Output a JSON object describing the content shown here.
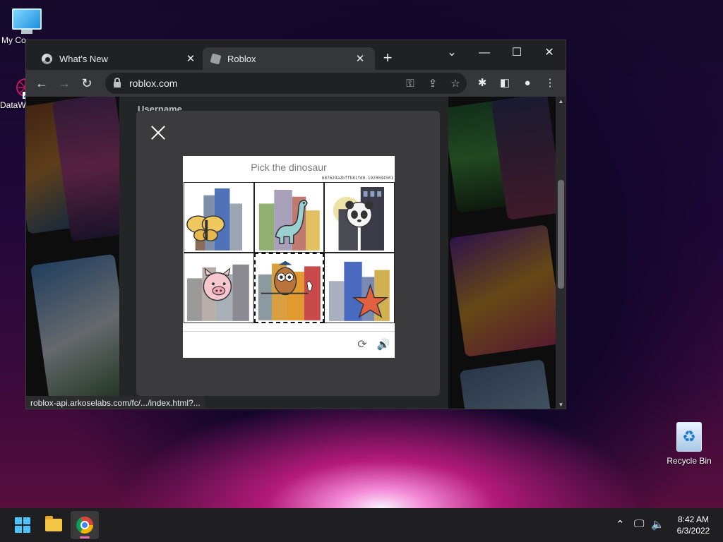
{
  "desktop": {
    "icons": [
      {
        "label": "My Co"
      },
      {
        "label": "DataW"
      },
      {
        "label": "Recycle Bin"
      }
    ]
  },
  "browser": {
    "tabs": [
      {
        "title": "What's New"
      },
      {
        "title": "Roblox"
      }
    ],
    "url": "roblox.com",
    "status_url": "roblox-api.arkoselabs.com/fc/.../index.html?..."
  },
  "page": {
    "username_label": "Username"
  },
  "captcha": {
    "prompt": "Pick the dinosaur",
    "session_id": "687629a2bffb81fd0.1920034501",
    "tiles": [
      {
        "animal": "butterfly"
      },
      {
        "animal": "dinosaur"
      },
      {
        "animal": "panda"
      },
      {
        "animal": "pig"
      },
      {
        "animal": "owl",
        "selected": true
      },
      {
        "animal": "starfish"
      }
    ]
  },
  "taskbar": {
    "time": "8:42 AM",
    "date": "6/3/2022"
  },
  "colors": {
    "browser_bg": "#202124",
    "toolbar_bg": "#35363a",
    "modal_bg": "#3b3b3d",
    "windows_accent": "#4cc2ff"
  }
}
